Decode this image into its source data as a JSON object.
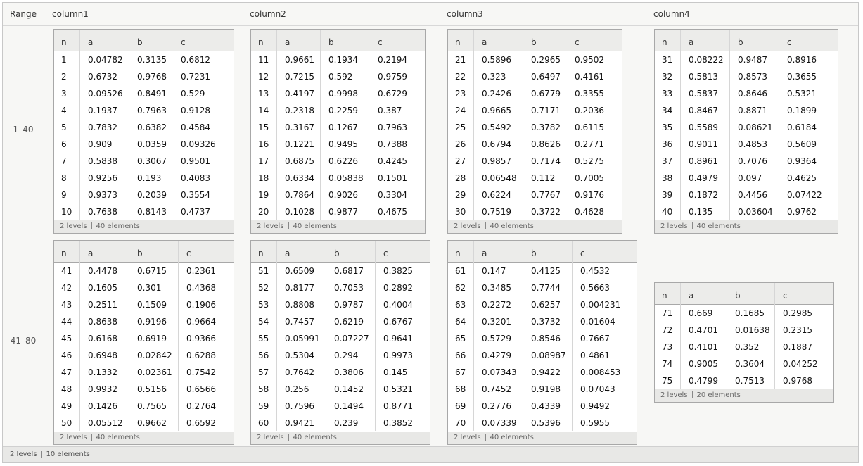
{
  "header": {
    "range": "Range",
    "columns": [
      "column1",
      "column2",
      "column3",
      "column4"
    ]
  },
  "row_labels": [
    "1–40",
    "41–80"
  ],
  "footer": {
    "levels": "2 levels",
    "elements": "10 elements"
  },
  "table_headers": [
    "n",
    "a",
    "b",
    "c"
  ],
  "tables": [
    {
      "levels": "2 levels",
      "elements": "40 elements",
      "rows": [
        [
          "1",
          "0.04782",
          "0.3135",
          "0.6812"
        ],
        [
          "2",
          "0.6732",
          "0.9768",
          "0.7231"
        ],
        [
          "3",
          "0.09526",
          "0.8491",
          "0.529"
        ],
        [
          "4",
          "0.1937",
          "0.7963",
          "0.9128"
        ],
        [
          "5",
          "0.7832",
          "0.6382",
          "0.4584"
        ],
        [
          "6",
          "0.909",
          "0.0359",
          "0.09326"
        ],
        [
          "7",
          "0.5838",
          "0.3067",
          "0.9501"
        ],
        [
          "8",
          "0.9256",
          "0.193",
          "0.4083"
        ],
        [
          "9",
          "0.9373",
          "0.2039",
          "0.3554"
        ],
        [
          "10",
          "0.7638",
          "0.8143",
          "0.4737"
        ]
      ]
    },
    {
      "levels": "2 levels",
      "elements": "40 elements",
      "rows": [
        [
          "11",
          "0.9661",
          "0.1934",
          "0.2194"
        ],
        [
          "12",
          "0.7215",
          "0.592",
          "0.9759"
        ],
        [
          "13",
          "0.4197",
          "0.9998",
          "0.6729"
        ],
        [
          "14",
          "0.2318",
          "0.2259",
          "0.387"
        ],
        [
          "15",
          "0.3167",
          "0.1267",
          "0.7963"
        ],
        [
          "16",
          "0.1221",
          "0.9495",
          "0.7388"
        ],
        [
          "17",
          "0.6875",
          "0.6226",
          "0.4245"
        ],
        [
          "18",
          "0.6334",
          "0.05838",
          "0.1501"
        ],
        [
          "19",
          "0.7864",
          "0.9026",
          "0.3304"
        ],
        [
          "20",
          "0.1028",
          "0.9877",
          "0.4675"
        ]
      ]
    },
    {
      "levels": "2 levels",
      "elements": "40 elements",
      "rows": [
        [
          "21",
          "0.5896",
          "0.2965",
          "0.9502"
        ],
        [
          "22",
          "0.323",
          "0.6497",
          "0.4161"
        ],
        [
          "23",
          "0.2426",
          "0.6779",
          "0.3355"
        ],
        [
          "24",
          "0.9665",
          "0.7171",
          "0.2036"
        ],
        [
          "25",
          "0.5492",
          "0.3782",
          "0.6115"
        ],
        [
          "26",
          "0.6794",
          "0.8626",
          "0.2771"
        ],
        [
          "27",
          "0.9857",
          "0.7174",
          "0.5275"
        ],
        [
          "28",
          "0.06548",
          "0.112",
          "0.7005"
        ],
        [
          "29",
          "0.6224",
          "0.7767",
          "0.9176"
        ],
        [
          "30",
          "0.7519",
          "0.3722",
          "0.4628"
        ]
      ]
    },
    {
      "levels": "2 levels",
      "elements": "40 elements",
      "rows": [
        [
          "31",
          "0.08222",
          "0.9487",
          "0.8916"
        ],
        [
          "32",
          "0.5813",
          "0.8573",
          "0.3655"
        ],
        [
          "33",
          "0.5837",
          "0.8646",
          "0.5321"
        ],
        [
          "34",
          "0.8467",
          "0.8871",
          "0.1899"
        ],
        [
          "35",
          "0.5589",
          "0.08621",
          "0.6184"
        ],
        [
          "36",
          "0.9011",
          "0.4853",
          "0.5609"
        ],
        [
          "37",
          "0.8961",
          "0.7076",
          "0.9364"
        ],
        [
          "38",
          "0.4979",
          "0.097",
          "0.4625"
        ],
        [
          "39",
          "0.1872",
          "0.4456",
          "0.07422"
        ],
        [
          "40",
          "0.135",
          "0.03604",
          "0.9762"
        ]
      ]
    },
    {
      "levels": "2 levels",
      "elements": "40 elements",
      "rows": [
        [
          "41",
          "0.4478",
          "0.6715",
          "0.2361"
        ],
        [
          "42",
          "0.1605",
          "0.301",
          "0.4368"
        ],
        [
          "43",
          "0.2511",
          "0.1509",
          "0.1906"
        ],
        [
          "44",
          "0.8638",
          "0.9196",
          "0.9664"
        ],
        [
          "45",
          "0.6168",
          "0.6919",
          "0.9366"
        ],
        [
          "46",
          "0.6948",
          "0.02842",
          "0.6288"
        ],
        [
          "47",
          "0.1332",
          "0.02361",
          "0.7542"
        ],
        [
          "48",
          "0.9932",
          "0.5156",
          "0.6566"
        ],
        [
          "49",
          "0.1426",
          "0.7565",
          "0.2764"
        ],
        [
          "50",
          "0.05512",
          "0.9662",
          "0.6592"
        ]
      ]
    },
    {
      "levels": "2 levels",
      "elements": "40 elements",
      "rows": [
        [
          "51",
          "0.6509",
          "0.6817",
          "0.3825"
        ],
        [
          "52",
          "0.8177",
          "0.7053",
          "0.2892"
        ],
        [
          "53",
          "0.8808",
          "0.9787",
          "0.4004"
        ],
        [
          "54",
          "0.7457",
          "0.6219",
          "0.6767"
        ],
        [
          "55",
          "0.05991",
          "0.07227",
          "0.9641"
        ],
        [
          "56",
          "0.5304",
          "0.294",
          "0.9973"
        ],
        [
          "57",
          "0.7642",
          "0.3806",
          "0.145"
        ],
        [
          "58",
          "0.256",
          "0.1452",
          "0.5321"
        ],
        [
          "59",
          "0.7596",
          "0.1494",
          "0.8771"
        ],
        [
          "60",
          "0.9421",
          "0.239",
          "0.3852"
        ]
      ]
    },
    {
      "levels": "2 levels",
      "elements": "40 elements",
      "rows": [
        [
          "61",
          "0.147",
          "0.4125",
          "0.4532"
        ],
        [
          "62",
          "0.3485",
          "0.7744",
          "0.5663"
        ],
        [
          "63",
          "0.2272",
          "0.6257",
          "0.004231"
        ],
        [
          "64",
          "0.3201",
          "0.3732",
          "0.01604"
        ],
        [
          "65",
          "0.5729",
          "0.8546",
          "0.7667"
        ],
        [
          "66",
          "0.4279",
          "0.08987",
          "0.4861"
        ],
        [
          "67",
          "0.07343",
          "0.9422",
          "0.008453"
        ],
        [
          "68",
          "0.7452",
          "0.9198",
          "0.07043"
        ],
        [
          "69",
          "0.2776",
          "0.4339",
          "0.9492"
        ],
        [
          "70",
          "0.07339",
          "0.5396",
          "0.5955"
        ]
      ]
    },
    {
      "levels": "2 levels",
      "elements": "20 elements",
      "rows": [
        [
          "71",
          "0.669",
          "0.1685",
          "0.2985"
        ],
        [
          "72",
          "0.4701",
          "0.01638",
          "0.2315"
        ],
        [
          "73",
          "0.4101",
          "0.352",
          "0.1887"
        ],
        [
          "74",
          "0.9005",
          "0.3604",
          "0.04252"
        ],
        [
          "75",
          "0.4799",
          "0.7513",
          "0.9768"
        ]
      ]
    }
  ]
}
